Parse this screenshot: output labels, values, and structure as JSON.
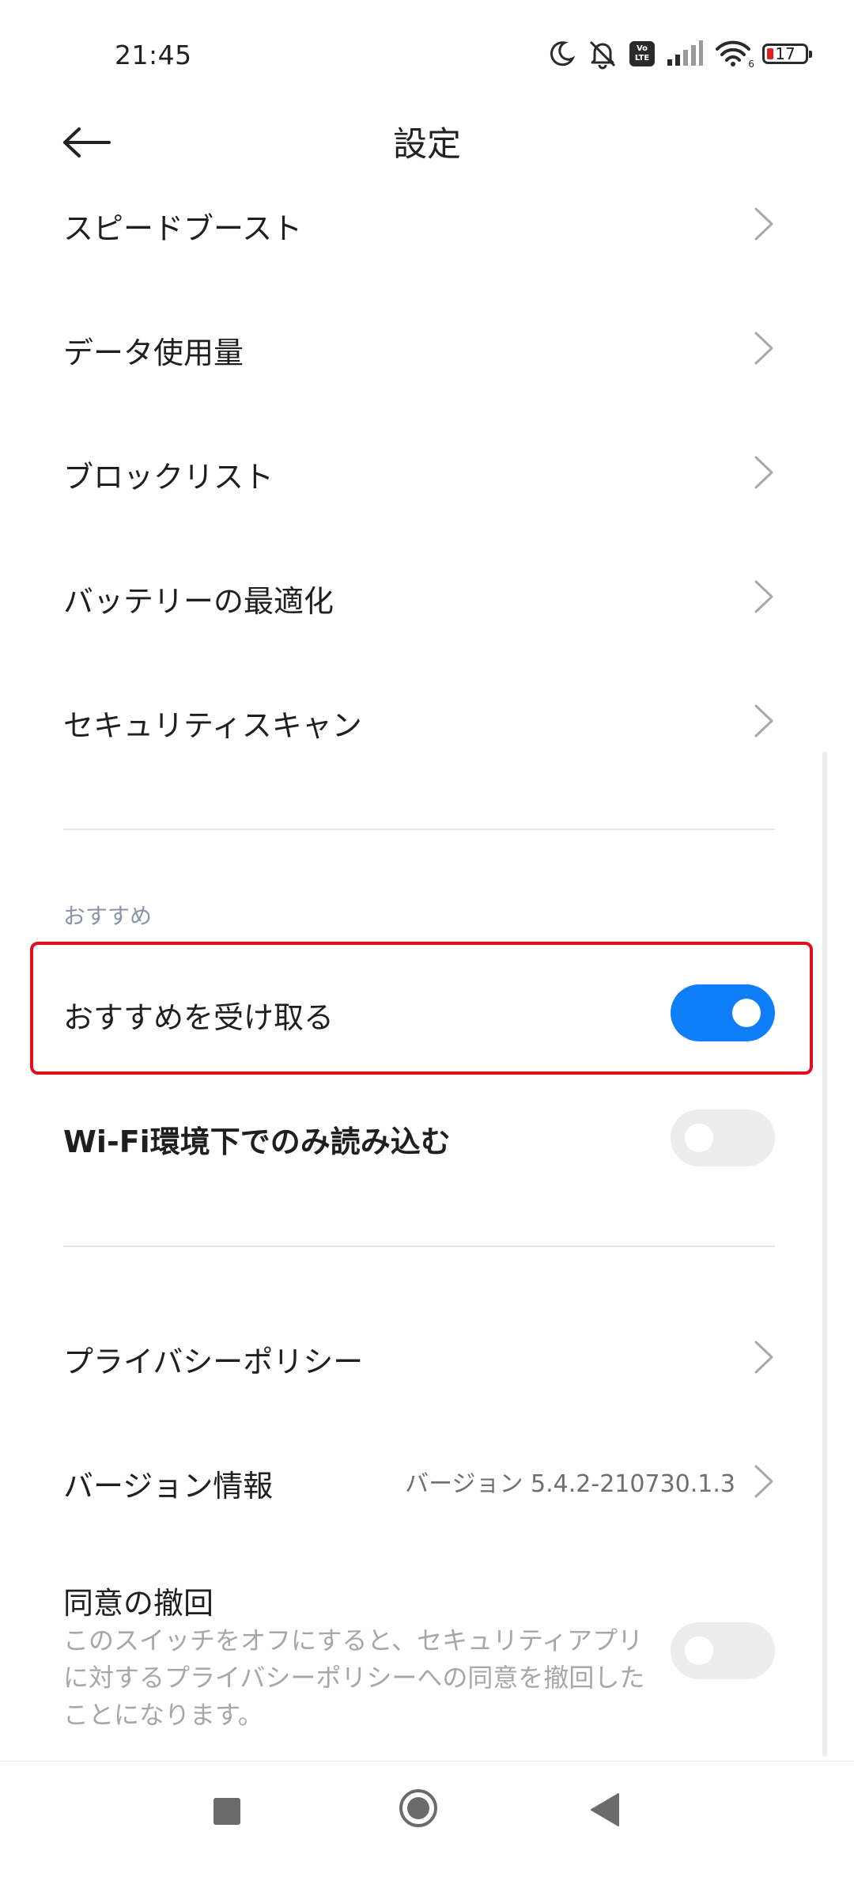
{
  "status_bar": {
    "time": "21:45",
    "icons": [
      "moon-icon",
      "bell-off-icon",
      "volte-icon",
      "signal-icon",
      "wifi-icon",
      "battery-icon"
    ],
    "volte_text": "Vo LTE",
    "wifi_badge": "6",
    "battery_level": "17",
    "battery_color": "#e02020"
  },
  "header": {
    "title": "設定",
    "back_icon": "arrow-left-icon"
  },
  "menu_items": [
    {
      "label": "スピードブースト"
    },
    {
      "label": "データ使用量"
    },
    {
      "label": "ブロックリスト"
    },
    {
      "label": "バッテリーの最適化"
    },
    {
      "label": "セキュリティスキャン"
    }
  ],
  "recommend_section": {
    "header": "おすすめ",
    "receive_label": "おすすめを受け取る",
    "receive_enabled": true,
    "wifi_only_label": "Wi-Fi環境下でのみ読み込む",
    "wifi_only_enabled": false
  },
  "about_section": {
    "privacy_label": "プライバシーポリシー",
    "version_label": "バージョン情報",
    "version_value": "バージョン 5.4.2-210730.1.3",
    "revoke_label": "同意の撤回",
    "revoke_desc": "このスイッチをオフにすると、セキュリティアプリに対するプライバシーポリシーへの同意を撤回したことになります。",
    "revoke_enabled": false
  },
  "colors": {
    "accent": "#0f7efb",
    "highlight_border": "#e0111c",
    "section_header": "#8a94a6"
  },
  "nav_bar": {
    "icons": [
      "recents-square-icon",
      "home-circle-icon",
      "back-triangle-icon"
    ]
  }
}
